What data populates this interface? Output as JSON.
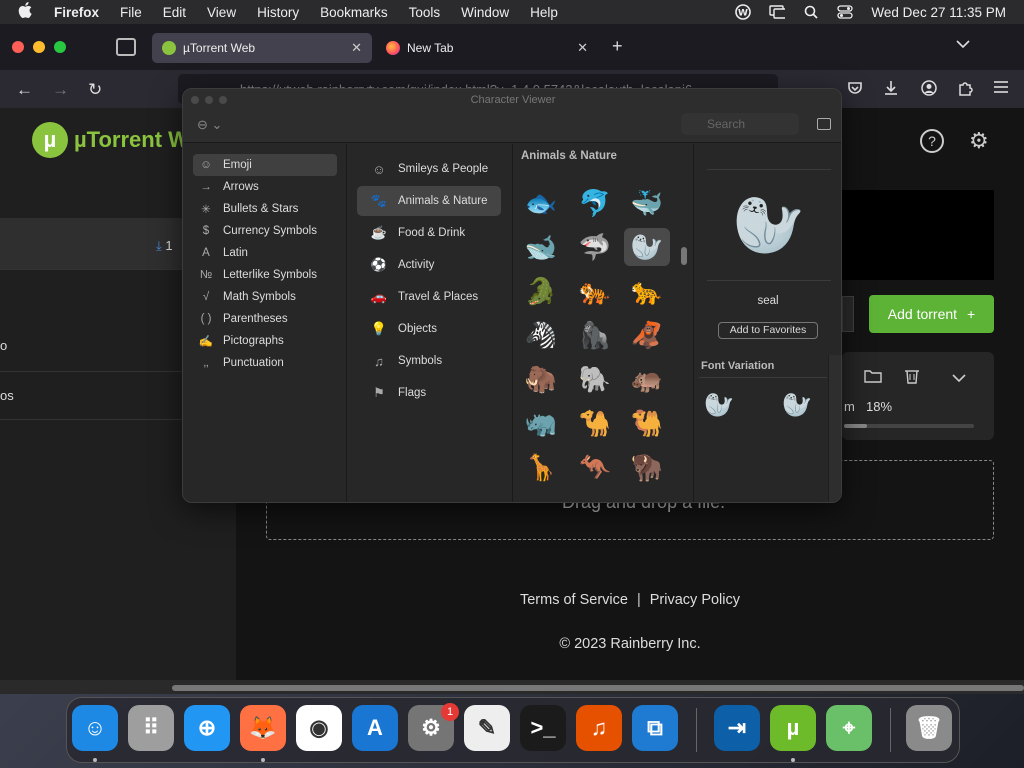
{
  "menubar": {
    "app": "Firefox",
    "items": [
      "File",
      "Edit",
      "View",
      "History",
      "Bookmarks",
      "Tools",
      "Window",
      "Help"
    ],
    "clock": "Wed Dec 27  11:35 PM"
  },
  "browser": {
    "tabs": [
      {
        "title": "µTorrent Web",
        "active": true
      },
      {
        "title": "New Tab",
        "active": false
      }
    ],
    "url": "https://utweb.rainberrytv.com/gui/index.html?v=1.4.0.5742&localauth=localapi6"
  },
  "utorrent": {
    "brand": "µTorrent Web",
    "download_count": "1",
    "side_label_1": "o",
    "side_label_2": "os",
    "add_torrent_label": "Add torrent",
    "speed_unit": "m",
    "progress_pct": "18%",
    "progress": 0.18,
    "dropzone_text": "Drag and drop a file.",
    "footer": {
      "terms": "Terms of Service",
      "privacy": "Privacy Policy",
      "copyright": "© 2023 Rainberry Inc."
    }
  },
  "character_viewer": {
    "title": "Character Viewer",
    "search_placeholder": "Search",
    "categories": [
      "Emoji",
      "Arrows",
      "Bullets & Stars",
      "Currency Symbols",
      "Latin",
      "Letterlike Symbols",
      "Math Symbols",
      "Parentheses",
      "Pictographs",
      "Punctuation"
    ],
    "category_icons": [
      "☺",
      "→",
      "✳",
      "$",
      "A",
      "№",
      "√",
      "( )",
      "✍",
      "‚‚"
    ],
    "selected_category": "Emoji",
    "subcategories": [
      "Smileys & People",
      "Animals & Nature",
      "Food & Drink",
      "Activity",
      "Travel & Places",
      "Objects",
      "Symbols",
      "Flags"
    ],
    "subcategory_icons": [
      "☺",
      "🐾",
      "☕",
      "⚽",
      "🚗",
      "💡",
      "♫",
      "⚑"
    ],
    "selected_subcategory": "Animals & Nature",
    "group_title": "Animals & Nature",
    "emoji_grid": [
      [
        "🐟",
        "🐬",
        "🐳"
      ],
      [
        "🐋",
        "🦈",
        "🦭"
      ],
      [
        "🐊",
        "🐅",
        "🐆"
      ],
      [
        "🦓",
        "🦍",
        "🦧"
      ],
      [
        "🦣",
        "🐘",
        "🦛"
      ],
      [
        "🦏",
        "🐪",
        "🐫"
      ],
      [
        "🦒",
        "🦘",
        "🦬"
      ]
    ],
    "selected_emoji": "🦭",
    "selected_name": "seal",
    "add_favorites_label": "Add to Favorites",
    "font_variation_label": "Font Variation",
    "font_variations": [
      "🦭",
      "🦭"
    ]
  },
  "dock": {
    "apps": [
      "Finder",
      "Launchpad",
      "Safari",
      "Firefox",
      "Chrome",
      "App Store",
      "System Settings",
      "TextEdit",
      "Terminal",
      "GarageBand",
      "VS Code",
      "Migration",
      "µTorrent",
      "Maps",
      "Trash"
    ],
    "settings_badge": "1"
  },
  "colors": {
    "accent": "#5cb335",
    "brand": "#8ac43f",
    "link": "#4a8bd6",
    "badge": "#e53935"
  }
}
